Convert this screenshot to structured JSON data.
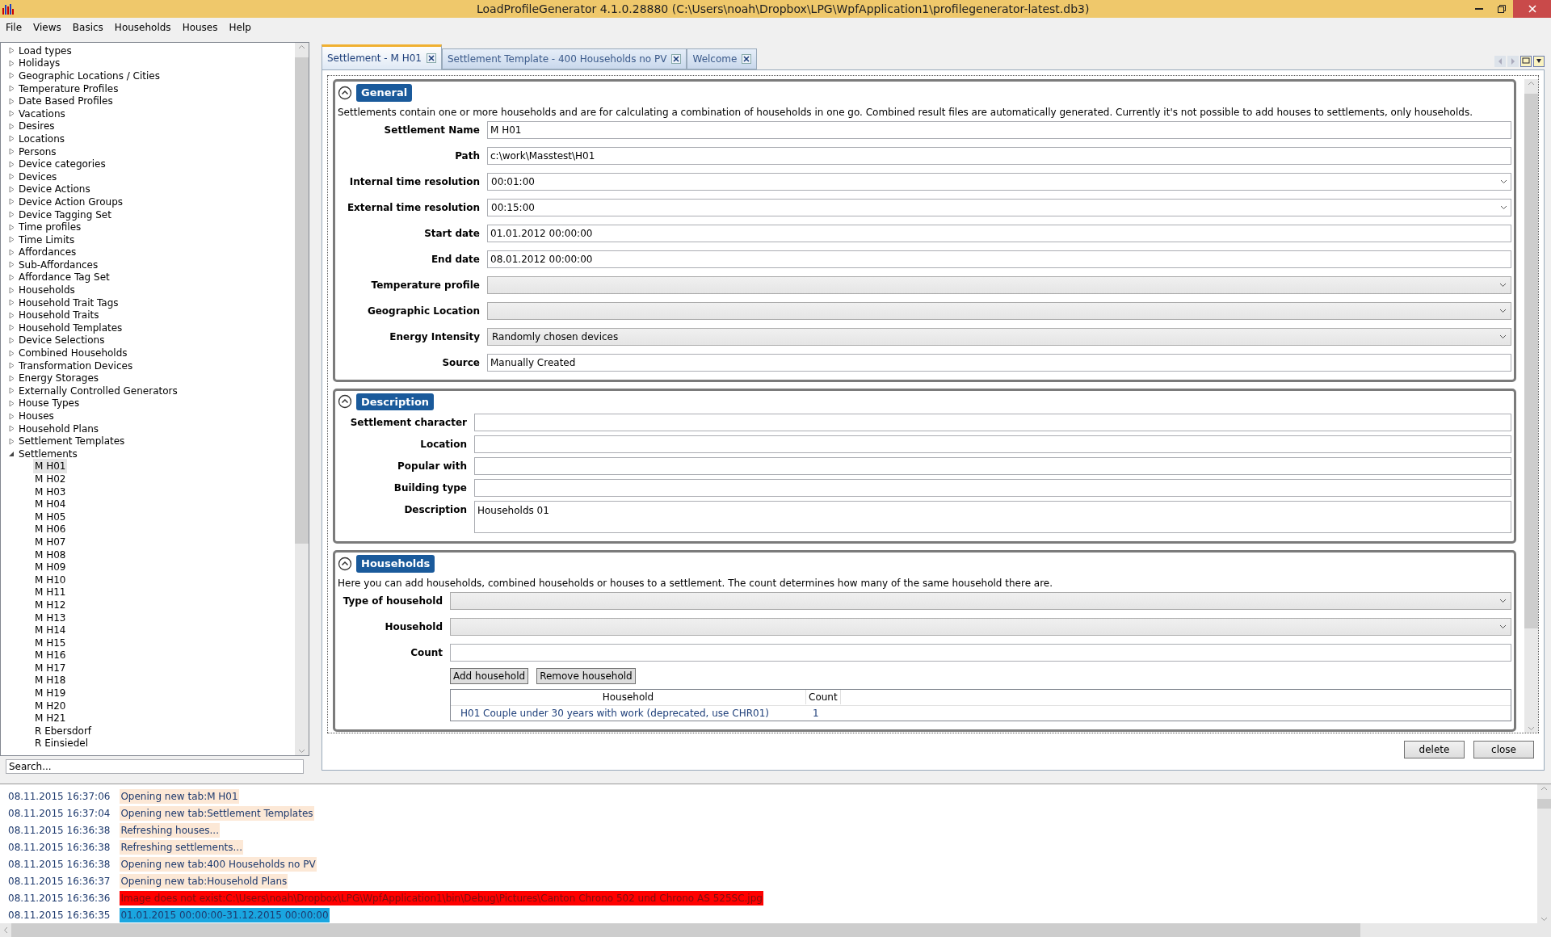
{
  "window": {
    "title": "LoadProfileGenerator 4.1.0.28880 (C:\\Users\\noah\\Dropbox\\LPG\\WpfApplication1\\profilegenerator-latest.db3)"
  },
  "menu": [
    "File",
    "Views",
    "Basics",
    "Households",
    "Houses",
    "Help"
  ],
  "sidebar": {
    "items": [
      {
        "label": "Load types",
        "expanded": false
      },
      {
        "label": "Holidays",
        "expanded": false
      },
      {
        "label": "Geographic Locations / Cities",
        "expanded": false
      },
      {
        "label": "Temperature Profiles",
        "expanded": false
      },
      {
        "label": "Date Based Profiles",
        "expanded": false
      },
      {
        "label": "Vacations",
        "expanded": false
      },
      {
        "label": "Desires",
        "expanded": false
      },
      {
        "label": "Locations",
        "expanded": false
      },
      {
        "label": "Persons",
        "expanded": false
      },
      {
        "label": "Device categories",
        "expanded": false
      },
      {
        "label": "Devices",
        "expanded": false
      },
      {
        "label": "Device Actions",
        "expanded": false
      },
      {
        "label": "Device Action Groups",
        "expanded": false
      },
      {
        "label": "Device Tagging Set",
        "expanded": false
      },
      {
        "label": "Time profiles",
        "expanded": false
      },
      {
        "label": "Time Limits",
        "expanded": false
      },
      {
        "label": "Affordances",
        "expanded": false
      },
      {
        "label": "Sub-Affordances",
        "expanded": false
      },
      {
        "label": "Affordance Tag Set",
        "expanded": false
      },
      {
        "label": "Households",
        "expanded": false
      },
      {
        "label": "Household Trait Tags",
        "expanded": false
      },
      {
        "label": "Household Traits",
        "expanded": false
      },
      {
        "label": "Household Templates",
        "expanded": false
      },
      {
        "label": "Device Selections",
        "expanded": false
      },
      {
        "label": "Combined Households",
        "expanded": false
      },
      {
        "label": "Transformation Devices",
        "expanded": false
      },
      {
        "label": "Energy Storages",
        "expanded": false
      },
      {
        "label": "Externally Controlled Generators",
        "expanded": false
      },
      {
        "label": "House Types",
        "expanded": false
      },
      {
        "label": "Houses",
        "expanded": false
      },
      {
        "label": "Household Plans",
        "expanded": false
      },
      {
        "label": "Settlement Templates",
        "expanded": false
      },
      {
        "label": "Settlements",
        "expanded": true,
        "children": [
          {
            "label": "M H01",
            "selected": true
          },
          {
            "label": "M H02",
            "selected": false
          },
          {
            "label": "M H03",
            "selected": false
          },
          {
            "label": "M H04",
            "selected": false
          },
          {
            "label": "M H05",
            "selected": false
          },
          {
            "label": "M H06",
            "selected": false
          },
          {
            "label": "M H07",
            "selected": false
          },
          {
            "label": "M H08",
            "selected": false
          },
          {
            "label": "M H09",
            "selected": false
          },
          {
            "label": "M H10",
            "selected": false
          },
          {
            "label": "M H11",
            "selected": false
          },
          {
            "label": "M H12",
            "selected": false
          },
          {
            "label": "M H13",
            "selected": false
          },
          {
            "label": "M H14",
            "selected": false
          },
          {
            "label": "M H15",
            "selected": false
          },
          {
            "label": "M H16",
            "selected": false
          },
          {
            "label": "M H17",
            "selected": false
          },
          {
            "label": "M H18",
            "selected": false
          },
          {
            "label": "M H19",
            "selected": false
          },
          {
            "label": "M H20",
            "selected": false
          },
          {
            "label": "M H21",
            "selected": false
          },
          {
            "label": "R Ebersdorf",
            "selected": false
          },
          {
            "label": "R Einsiedel",
            "selected": false
          }
        ]
      }
    ],
    "search": {
      "placeholder": "Search..."
    }
  },
  "tabs": [
    {
      "label": "Settlement - M H01",
      "selected": true
    },
    {
      "label": "Settlement Template - 400 Households no PV",
      "selected": false
    },
    {
      "label": "Welcome",
      "selected": false
    }
  ],
  "sections": [
    {
      "title": "General",
      "expanded": true,
      "description": "Settlements contain one or more households and are for calculating a combination of households in one go. Combined result files are automatically generated. Currently it's not possible to add houses to settlements, only households.",
      "fields": [
        {
          "label": "Settlement Name",
          "kind": "text",
          "value": "M H01"
        },
        {
          "label": "Path",
          "kind": "text",
          "value": "c:\\work\\Masstest\\H01"
        },
        {
          "label": "Internal time resolution",
          "kind": "editable-combo",
          "value": "00:01:00"
        },
        {
          "label": "External time resolution",
          "kind": "editable-combo",
          "value": "00:15:00"
        },
        {
          "label": "Start date",
          "kind": "text",
          "value": "01.01.2012 00:00:00"
        },
        {
          "label": "End date",
          "kind": "text",
          "value": "08.01.2012 00:00:00"
        },
        {
          "label": "Temperature profile",
          "kind": "combo"
        },
        {
          "label": "Geographic Location",
          "kind": "combo"
        },
        {
          "label": "Energy Intensity",
          "kind": "combo",
          "value": "Randomly chosen devices"
        },
        {
          "label": "Source",
          "kind": "text",
          "value": "Manually Created"
        }
      ]
    },
    {
      "title": "Description",
      "expanded": true,
      "fields": [
        {
          "label": "Settlement character",
          "kind": "text"
        },
        {
          "label": "Location",
          "kind": "text"
        },
        {
          "label": "Popular with",
          "kind": "text"
        },
        {
          "label": "Building type",
          "kind": "text"
        },
        {
          "label": "Description",
          "kind": "multiline",
          "value": "Households 01"
        }
      ]
    },
    {
      "title": "Households",
      "expanded": true,
      "description": "Here you can add households, combined households or houses to a settlement. The count determines how many of the same household there are.",
      "fields": [
        {
          "label": "Type of household",
          "kind": "combo"
        },
        {
          "label": "Household",
          "kind": "combo"
        },
        {
          "label": "Count",
          "kind": "text"
        }
      ],
      "buttons": [
        "Add household",
        "Remove household"
      ],
      "table": {
        "columns": [
          "Household",
          "Count"
        ],
        "rows": [
          [
            "H01 Couple under 30 years with work (deprecated, use CHR01)",
            "1"
          ]
        ]
      }
    }
  ],
  "footer_buttons": [
    "delete",
    "close"
  ],
  "log": [
    {
      "time": "08.11.2015 16:37:06",
      "message": "Opening new tab:M H01",
      "kind": "info"
    },
    {
      "time": "08.11.2015 16:37:04",
      "message": "Opening new tab:Settlement Templates",
      "kind": "info"
    },
    {
      "time": "08.11.2015 16:36:38",
      "message": "Refreshing houses...",
      "kind": "info"
    },
    {
      "time": "08.11.2015 16:36:38",
      "message": "Refreshing settlements...",
      "kind": "info"
    },
    {
      "time": "08.11.2015 16:36:38",
      "message": "Opening new tab:400 Households no PV",
      "kind": "info"
    },
    {
      "time": "08.11.2015 16:36:37",
      "message": "Opening new tab:Household Plans",
      "kind": "info"
    },
    {
      "time": "08.11.2015 16:36:36",
      "message": "Image does not exist:C:\\Users\\noah\\Dropbox\\LPG\\WpfApplication1\\bin\\Debug\\Pictures\\Canton Chrono 502 und Chrono AS 525SC.jpg",
      "kind": "error"
    },
    {
      "time": "08.11.2015 16:36:35",
      "message": "01.01.2015 00:00:00-31.12.2015 00:00:00",
      "kind": "highlight"
    }
  ]
}
